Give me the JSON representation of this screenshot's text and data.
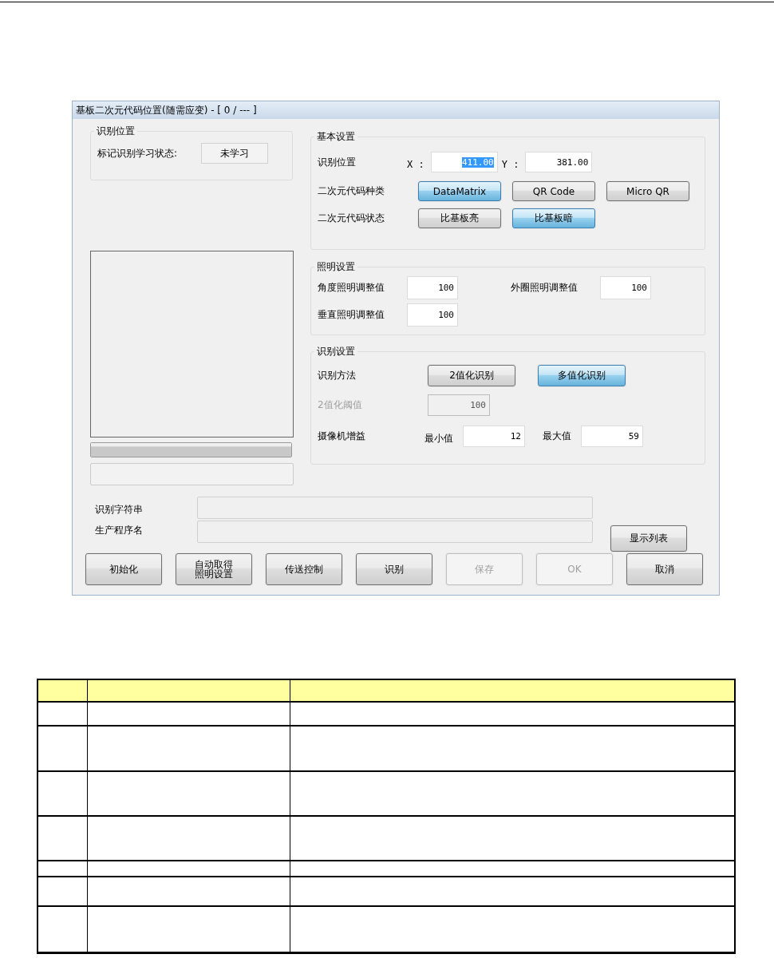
{
  "window": {
    "title": "基板二次元代码位置(随需应变)  - [ 0 / --- ]"
  },
  "recognition_position": {
    "title": "识别位置",
    "status_label": "标记识别学习状态:",
    "status_value": "未学习"
  },
  "progress": {
    "level": 1
  },
  "basic_settings": {
    "title": "基本设置",
    "position_label": "识别位置",
    "x_label": "X :",
    "x_value": "411.00",
    "x_value_highlighted": true,
    "y_label": "Y :",
    "y_value": "381.00",
    "code_type_label": "二次元代码种类",
    "code_types": [
      {
        "label": "DataMatrix",
        "selected": true
      },
      {
        "label": "QR Code",
        "selected": false
      },
      {
        "label": "Micro QR",
        "selected": false
      }
    ],
    "code_state_label": "二次元代码状态",
    "code_states": [
      {
        "label": "比基板亮",
        "selected": false
      },
      {
        "label": "比基板暗",
        "selected": true
      }
    ]
  },
  "lighting_settings": {
    "title": "照明设置",
    "fields": [
      {
        "label": "角度照明调整值",
        "value": "100"
      },
      {
        "label": "外圈照明调整值",
        "value": "100"
      },
      {
        "label": "垂直照明调整值",
        "value": "100"
      }
    ]
  },
  "recognition_settings": {
    "title": "识别设置",
    "method_label": "识别方法",
    "methods": [
      {
        "label": "2值化识别",
        "selected": false
      },
      {
        "label": "多值化识别",
        "selected": true
      }
    ],
    "threshold": {
      "label": "2值化阈值",
      "value": "100",
      "disabled": true
    },
    "gain_label": "摄像机增益",
    "min_label": "最小值",
    "min_value": "12",
    "max_label": "最大值",
    "max_value": "59"
  },
  "recognized_string_label": "识别字符串",
  "program_name_label": "生产程序名",
  "show_list_button": "显示列表",
  "buttons": [
    {
      "label": "初始化",
      "disabled": false
    },
    {
      "label": "自动取得照明设置",
      "disabled": false
    },
    {
      "label": "传送控制",
      "disabled": false
    },
    {
      "label": "识别",
      "disabled": false
    },
    {
      "label": "保存",
      "disabled": true
    },
    {
      "label": "OK",
      "disabled": true
    },
    {
      "label": "取消",
      "disabled": false
    }
  ]
}
